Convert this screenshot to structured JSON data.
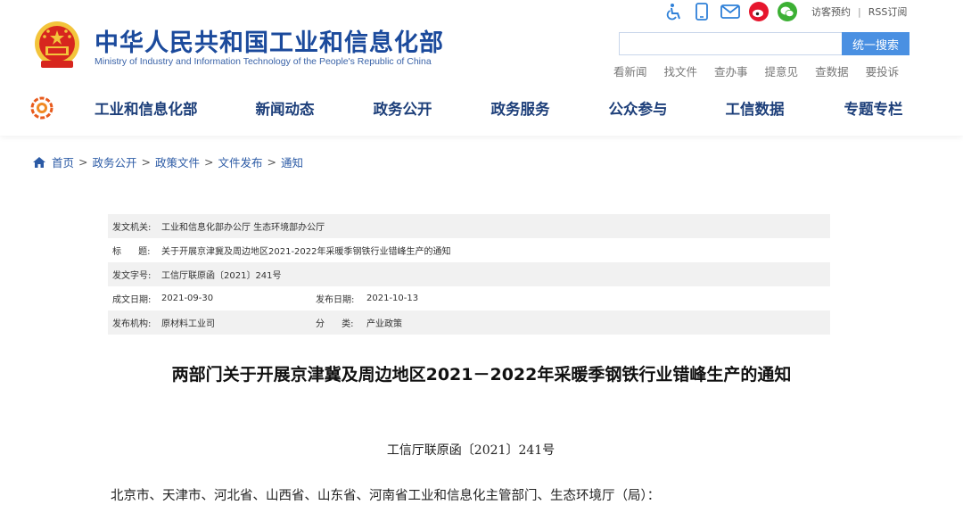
{
  "header": {
    "site_title": "中华人民共和国工业和信息化部",
    "site_subtitle": "Ministry of Industry and Information Technology of the People's Republic of China",
    "tool_icons": [
      "accessibility-icon",
      "mobile-icon",
      "mail-icon",
      "weibo-icon",
      "wechat-icon"
    ],
    "top_links": {
      "visit": "访客预约",
      "separator": "|",
      "rss": "RSS订阅"
    },
    "search": {
      "value": "",
      "button_label": "统一搜索"
    },
    "quick_links": [
      "看新闻",
      "找文件",
      "查办事",
      "提意见",
      "查数据",
      "要投诉"
    ]
  },
  "nav": {
    "items": [
      "工业和信息化部",
      "新闻动态",
      "政务公开",
      "政务服务",
      "公众参与",
      "工信数据",
      "专题专栏"
    ]
  },
  "breadcrumb": {
    "items": [
      "首页",
      "政务公开",
      "政策文件",
      "文件发布",
      "通知"
    ],
    "separator": ">"
  },
  "info_table": {
    "issuer_label": "发文机关:",
    "issuer": "工业和信息化部办公厅 生态环境部办公厅",
    "title_label": "标      题:",
    "title": "关于开展京津冀及周边地区2021-2022年采暖季钢铁行业错峰生产的通知",
    "doc_no_label": "发文字号:",
    "doc_no": "工信厅联原函〔2021〕241号",
    "created_label": "成文日期:",
    "created": "2021-09-30",
    "published_label": "发布日期:",
    "published": "2021-10-13",
    "org_label": "发布机构:",
    "org": "原材料工业司",
    "category_label": "分      类:",
    "category": "产业政策"
  },
  "document": {
    "title": "两部门关于开展京津冀及周边地区2021－2022年采暖季钢铁行业错峰生产的通知",
    "number": "工信厅联原函〔2021〕241号",
    "recipients": "北京市、天津市、河北省、山西省、山东省、河南省工业和信息化主管部门、生态环境厅（局）："
  },
  "colors": {
    "brand_blue": "#1b4a9c",
    "nav_text": "#1d3f7a",
    "search_button": "#4a90e2",
    "emblem_red": "#d7261e",
    "emblem_gold": "#f3c43b",
    "weibo_red": "#e6162d",
    "wechat_green": "#3cb034"
  }
}
